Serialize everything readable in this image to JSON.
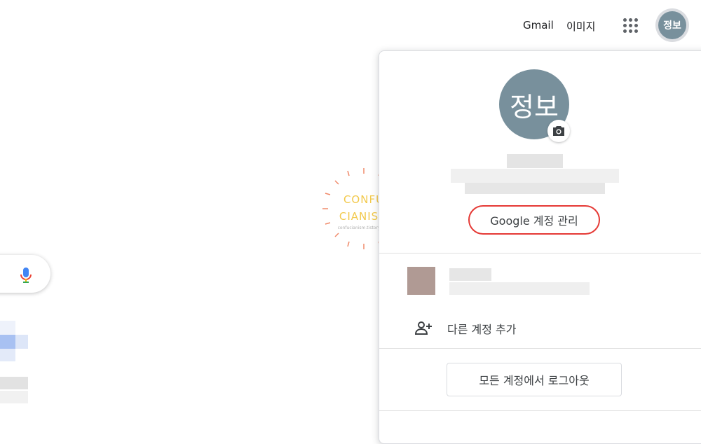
{
  "header": {
    "gmail_label": "Gmail",
    "images_label": "이미지",
    "apps_icon": "apps-grid-icon",
    "avatar_initials": "정보"
  },
  "search": {
    "mic_icon": "microphone-icon"
  },
  "watermark": {
    "line1": "CONFU",
    "line2": "CIANISM",
    "url": "confucianism.tistory.com"
  },
  "account_panel": {
    "avatar_initials": "정보",
    "camera_icon": "camera-icon",
    "manage_account_label": "Google 계정 관리",
    "add_account_label": "다른 계정 추가",
    "add_account_icon": "person-add-icon",
    "signout_label": "모든 계정에서 로그아웃",
    "highlight_color": "#e53935",
    "avatar_color": "#78909c"
  }
}
